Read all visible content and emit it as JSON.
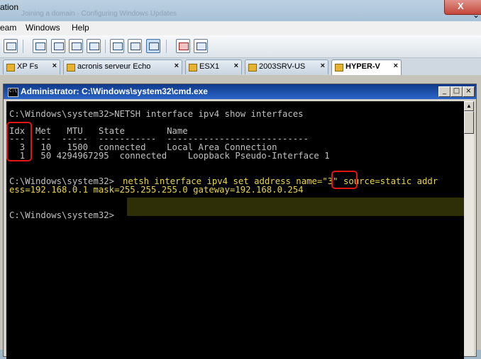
{
  "outer_window": {
    "title_fragment": "ation",
    "ghost_text": "Joining a domain · Configuring Windows Updates"
  },
  "menu": {
    "items": [
      "eam",
      "Windows",
      "Help"
    ]
  },
  "tabs": [
    {
      "label": "XP Fs"
    },
    {
      "label": "acronis serveur Echo"
    },
    {
      "label": "ESX1"
    },
    {
      "label": "2003SRV-US"
    },
    {
      "label": "HYPER-V",
      "active": true
    }
  ],
  "cmd": {
    "title": "Administrator: C:\\Windows\\system32\\cmd.exe",
    "lines": [
      "C:\\Windows\\system32>NETSH interface ipv4 show interfaces",
      "",
      "Idx  Met   MTU   State        Name",
      "---  ---  -----  -----------  ---------------------------",
      "  3   10   1500  connected    Local Area Connection",
      "  1   50 4294967295  connected    Loopback Pseudo-Interface 1",
      "",
      "",
      "C:\\Windows\\system32>",
      "ess=192.168.0.1 mask=255.255.255.0 gateway=192.168.0.254",
      "",
      "",
      "C:\\Windows\\system32>"
    ],
    "command_highlight": "netsh interface ipv4 set address name=\"3\" source=static addr"
  },
  "colors": {
    "annotation": "#e01414",
    "highlight_text": "#e8d44a",
    "console_bg": "#000000",
    "titlebar": "#1d4fa8"
  }
}
